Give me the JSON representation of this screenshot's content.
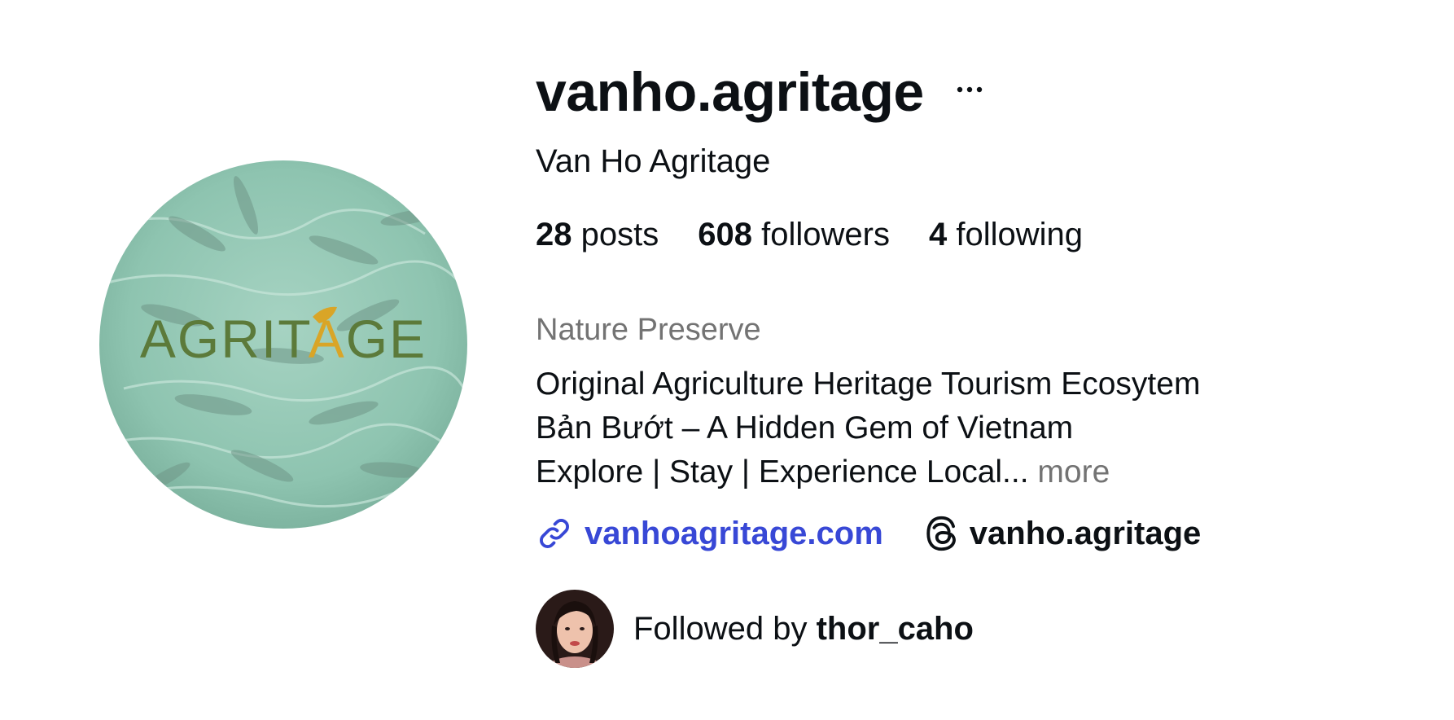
{
  "profile": {
    "username": "vanho.agritage",
    "full_name": "Van Ho Agritage",
    "avatar_logo_text": "AGRITAGE",
    "stats": {
      "posts_count": "28",
      "posts_label": "posts",
      "followers_count": "608",
      "followers_label": "followers",
      "following_count": "4",
      "following_label": "following"
    },
    "category": "Nature Preserve",
    "bio": {
      "line1": "Original Agriculture Heritage Tourism Ecosytem",
      "line2": "Bản Bướt – A Hidden Gem of Vietnam",
      "line3": "Explore | Stay | Experience Local...",
      "more_label": "more"
    },
    "links": {
      "website": "vanhoagritage.com",
      "threads_handle": "vanho.agritage"
    },
    "followed_by": {
      "prefix": "Followed by",
      "username": "thor_caho"
    }
  },
  "icons": {
    "more": "more-horizontal-icon",
    "link": "link-icon",
    "threads": "threads-icon"
  },
  "colors": {
    "text": "#0c1014",
    "secondary": "#737373",
    "link": "#3848d6",
    "logo_green": "#5c7a3a",
    "logo_gold": "#d9a527",
    "water": "#8ec4b0"
  }
}
